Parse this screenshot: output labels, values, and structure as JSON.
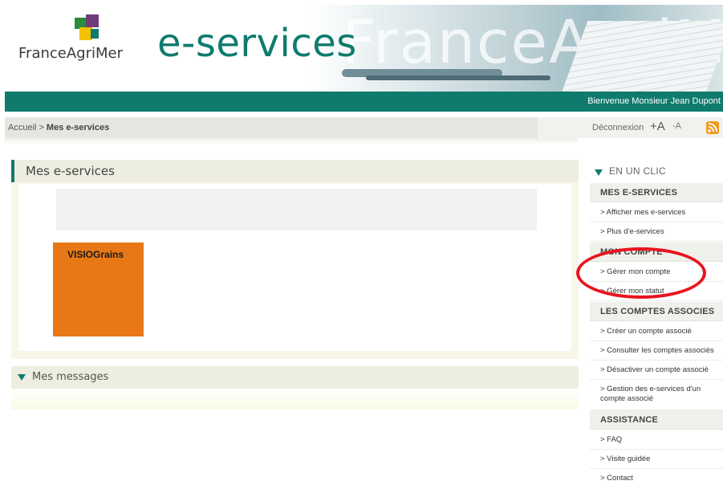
{
  "header": {
    "brand": "FranceAgriMer",
    "product": "e-services",
    "banner_text": "FranceAgriMer",
    "welcome": "Bienvenue Monsieur Jean Dupont"
  },
  "breadcrumb": {
    "home": "Accueil",
    "separator": ">",
    "current": "Mes e-services"
  },
  "tools": {
    "logout": "Déconnexion",
    "font_increase": "+A",
    "font_decrease": "-A",
    "rss_icon": "rss-icon"
  },
  "main": {
    "title": "Mes e-services",
    "tiles": [
      {
        "label": "VISIOGrains",
        "color": "#e87816"
      }
    ]
  },
  "messages": {
    "title": "Mes messages"
  },
  "sidebar": {
    "title": "EN UN CLIC",
    "sections": [
      {
        "heading": "MES E-SERVICES",
        "links": [
          "> Afficher mes e-services",
          "> Plus d'e-services"
        ]
      },
      {
        "heading": "MON COMPTE",
        "links": [
          "> Gérer mon compte",
          "> Gérer mon statut"
        ]
      },
      {
        "heading": "LES COMPTES ASSOCIES",
        "links": [
          "> Créer un compte associé",
          "> Consulter les comptes associés",
          "> Désactiver un compte associé",
          "> Gestion des e-services d'un compte associé"
        ]
      },
      {
        "heading": "ASSISTANCE",
        "links": [
          "> FAQ",
          "> Visite guidée",
          "> Contact"
        ]
      }
    ]
  },
  "colors": {
    "brand_green": "#0f7b6c",
    "tile_orange": "#e87816",
    "highlight_red": "#e8141e"
  }
}
